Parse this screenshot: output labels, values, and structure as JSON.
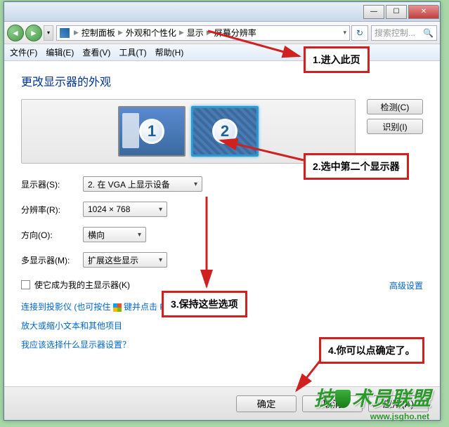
{
  "titlebar": {
    "min": "—",
    "max": "☐",
    "close": "✕"
  },
  "nav": {
    "back": "◄",
    "fwd": "►",
    "dropdown": "▾",
    "refresh": "↻"
  },
  "breadcrumb": {
    "root": "控制面板",
    "cat": "外观和个性化",
    "sub": "显示",
    "leaf": "屏幕分辨率"
  },
  "search": {
    "placeholder": "搜索控制...",
    "icon": "🔍"
  },
  "menu": {
    "file": "文件(F)",
    "edit": "编辑(E)",
    "view": "查看(V)",
    "tools": "工具(T)",
    "help": "帮助(H)"
  },
  "page_title": "更改显示器的外观",
  "monitors": {
    "one": "1",
    "two": "2"
  },
  "side": {
    "detect": "检测(C)",
    "identify": "识别(I)"
  },
  "settings": {
    "display_label": "显示器(S):",
    "display_value": "2. 在 VGA 上显示设备",
    "res_label": "分辨率(R):",
    "res_value": "1024 × 768",
    "orient_label": "方向(O):",
    "orient_value": "横向",
    "multi_label": "多显示器(M):",
    "multi_value": "扩展这些显示"
  },
  "checkbox_label": "使它成为我的主显示器(K)",
  "adv_link": "高级设置",
  "links": {
    "projector_a": "连接到投影仪 (也可按住 ",
    "projector_b": " 键并点击 P)",
    "textsize": "放大或缩小文本和其他项目",
    "help": "我应该选择什么显示器设置？"
  },
  "footer": {
    "ok": "确定",
    "cancel": "取消",
    "apply": "应用(A)"
  },
  "callouts": {
    "c1": "1.进入此页",
    "c2": "2.选中第二个显示器",
    "c3": "3.保持这些选项",
    "c4": "4.你可以点确定了。"
  },
  "watermark": {
    "text_a": "技",
    "text_b": "术员联盟",
    "url": "www.jsgho.net"
  }
}
